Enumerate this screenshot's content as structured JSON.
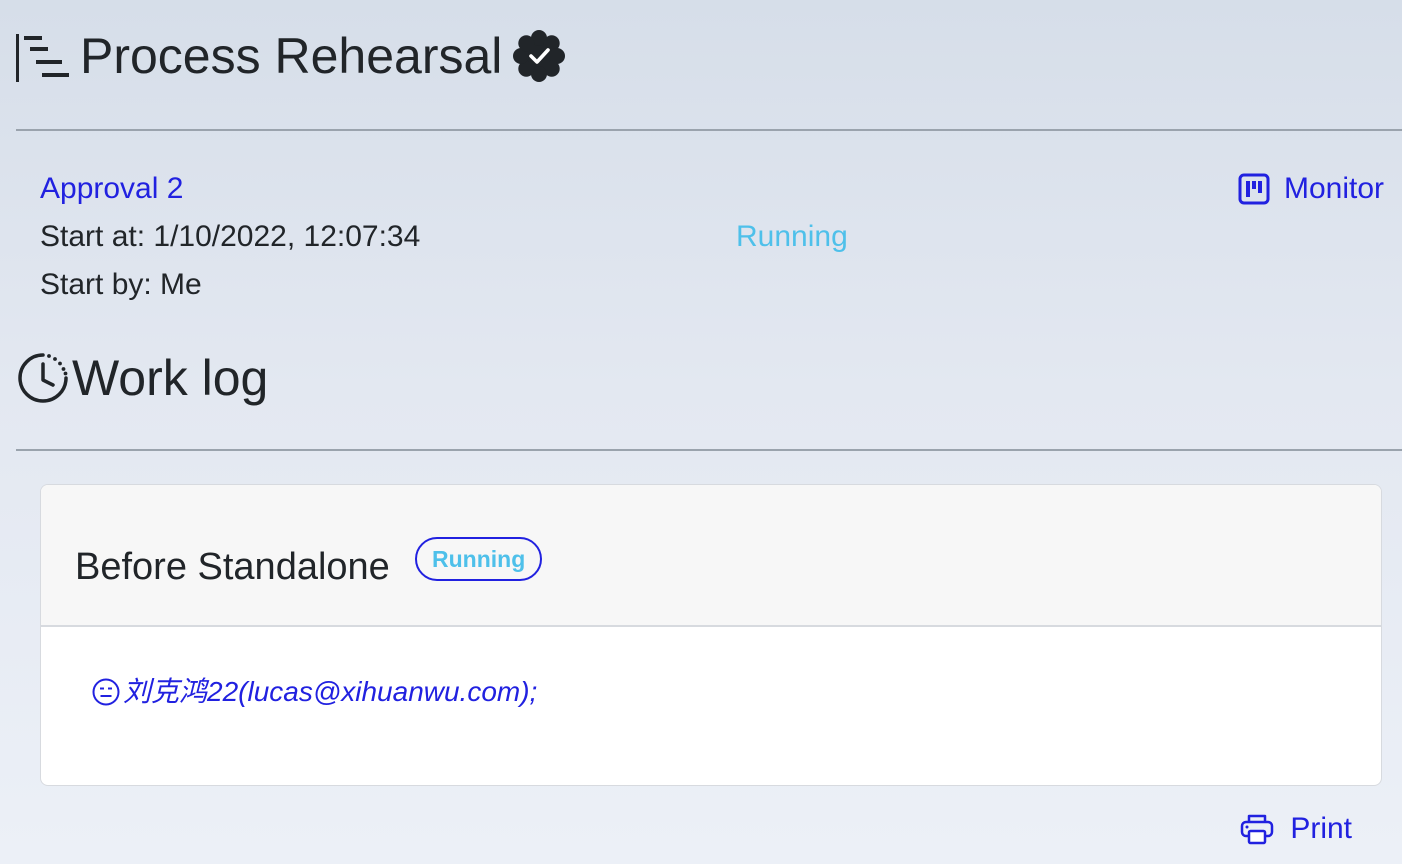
{
  "header": {
    "title": "Process Rehearsal",
    "title_icon": "flow-tree-icon",
    "verified_icon": "patch-check-icon"
  },
  "process": {
    "name": "Approval 2",
    "start_at": "Start at: 1/10/2022, 12:07:34",
    "start_by": "Start by: Me",
    "status": "Running",
    "monitor_label": "Monitor",
    "monitor_icon": "kanban-icon"
  },
  "worklog": {
    "title": "Work log",
    "icon": "clock-history-icon",
    "entries": [
      {
        "title": "Before Standalone",
        "status": "Running",
        "assignee": "刘克鸿22(lucas@xihuanwu.com);",
        "assignee_icon": "emoji-neutral-icon"
      }
    ]
  },
  "footer": {
    "print_label": "Print",
    "print_icon": "printer-icon"
  },
  "colors": {
    "link": "#2121e0",
    "status_running": "#4ec0ea",
    "text": "#212529",
    "rule": "#9aa3ad",
    "card_header_bg": "#f7f7f7"
  }
}
